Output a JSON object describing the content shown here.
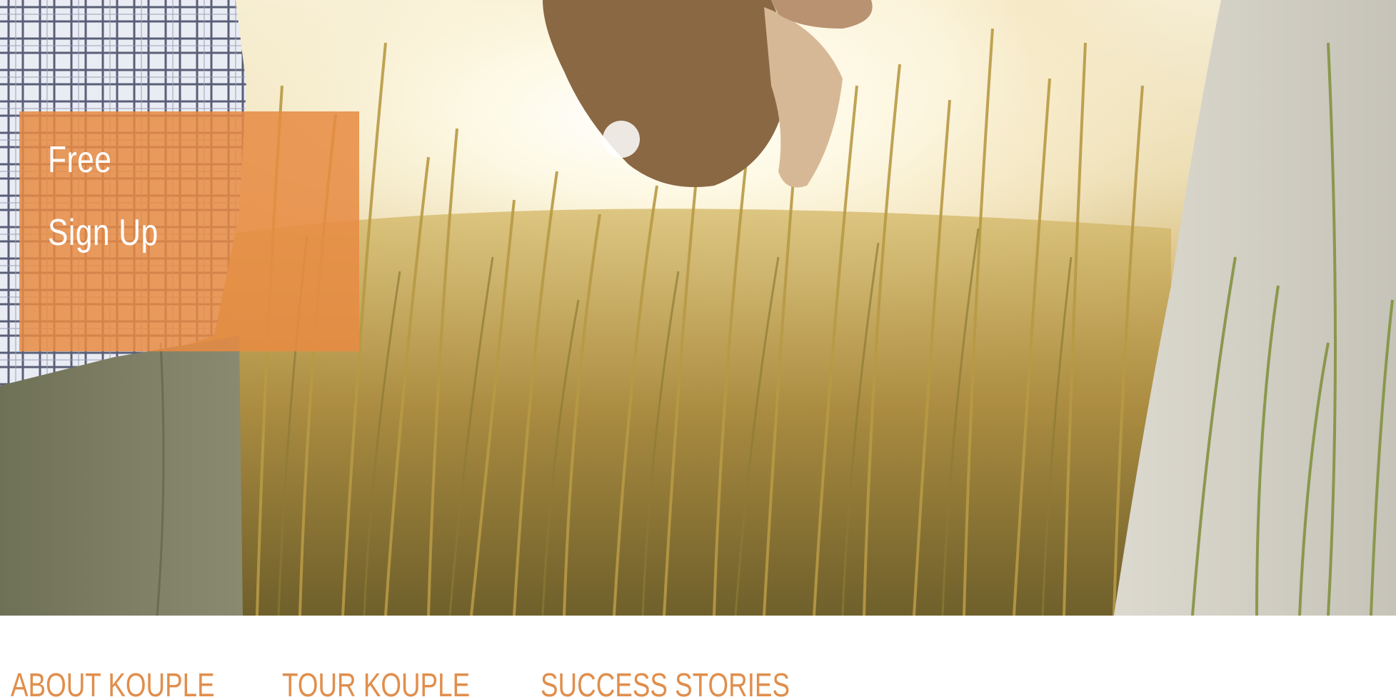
{
  "hero": {
    "image_alt": "Couple holding hands in sunlit tall grass"
  },
  "signup": {
    "line1": "Free",
    "line2": "Sign Up",
    "color": "#e88a42"
  },
  "nav": {
    "about": "ABOUT KOUPLE",
    "tour": "TOUR KOUPLE",
    "stories": "SUCCESS STORIES",
    "color": "#e08e4c"
  }
}
